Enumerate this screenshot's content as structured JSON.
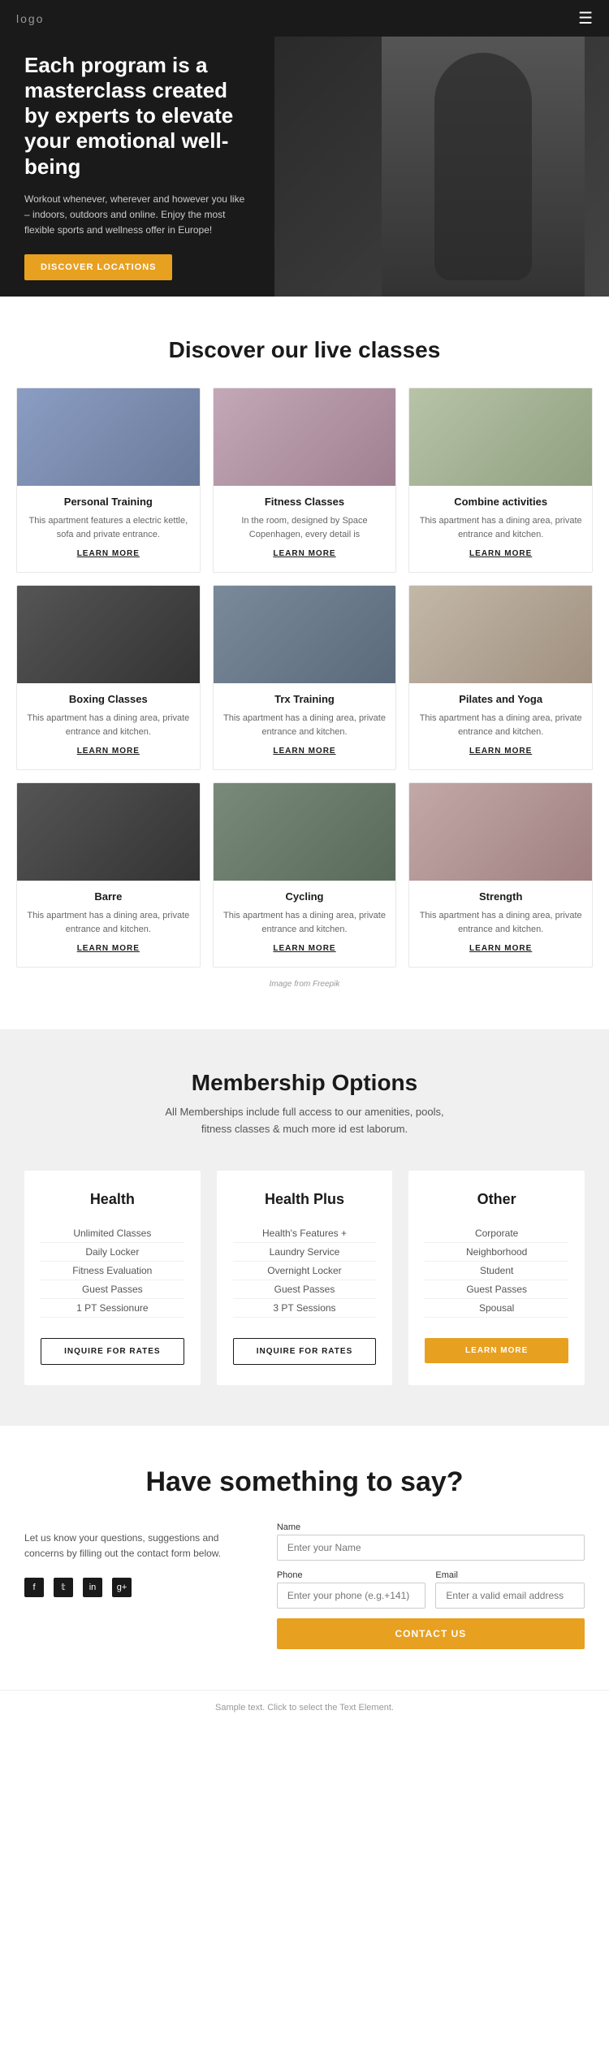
{
  "header": {
    "logo": "logo",
    "menu_icon": "☰"
  },
  "hero": {
    "title": "Each program is a masterclass created by experts to elevate your emotional well-being",
    "subtitle": "Workout whenever, wherever and however you like – indoors, outdoors and online. Enjoy the most flexible sports and wellness offer in Europe!",
    "cta_label": "DISCOVER LOCATIONS"
  },
  "live_classes": {
    "section_title": "Discover our live classes",
    "freepik_note": "Image from Freepik",
    "cards": [
      {
        "name": "Personal Training",
        "desc": "This apartment features a electric kettle, sofa and private entrance.",
        "learn_more": "LEARN MORE",
        "img_class": "img-personal"
      },
      {
        "name": "Fitness Classes",
        "desc": "In the room, designed by Space Copenhagen, every detail is",
        "learn_more": "LEARN MORE",
        "img_class": "img-fitness"
      },
      {
        "name": "Combine activities",
        "desc": "This apartment has a dining area, private entrance and kitchen.",
        "learn_more": "LEARN MORE",
        "img_class": "img-combine"
      },
      {
        "name": "Boxing Classes",
        "desc": "This apartment has a dining area, private entrance and kitchen.",
        "learn_more": "LEARN MORE",
        "img_class": "img-boxing"
      },
      {
        "name": "Trx Training",
        "desc": "This apartment has a dining area, private entrance and kitchen.",
        "learn_more": "LEARN MORE",
        "img_class": "img-trx"
      },
      {
        "name": "Pilates and Yoga",
        "desc": "This apartment has a dining area, private entrance and kitchen.",
        "learn_more": "LEARN MORE",
        "img_class": "img-pilates"
      },
      {
        "name": "Barre",
        "desc": "This apartment has a dining area, private entrance and kitchen.",
        "learn_more": "LEARN MORE",
        "img_class": "img-barre"
      },
      {
        "name": "Cycling",
        "desc": "This apartment has a dining area, private entrance and kitchen.",
        "learn_more": "LEARN MORE",
        "img_class": "img-cycling"
      },
      {
        "name": "Strength",
        "desc": "This apartment has a dining area, private entrance and kitchen.",
        "learn_more": "LEARN MORE",
        "img_class": "img-strength"
      }
    ]
  },
  "membership": {
    "section_title": "Membership Options",
    "subtitle": "All Memberships include full access to our amenities, pools, fitness classes & much more id est laborum.",
    "plans": [
      {
        "title": "Health",
        "features": [
          "Unlimited Classes",
          "Daily Locker",
          "Fitness Evaluation",
          "Guest Passes",
          "1 PT Sessionure"
        ],
        "btn_label": "INQUIRE FOR RATES",
        "btn_type": "outline"
      },
      {
        "title": "Health Plus",
        "features": [
          "Health's Features +",
          "Laundry Service",
          "Overnight Locker",
          "Guest Passes",
          "3 PT Sessions"
        ],
        "btn_label": "INQUIRE FOR RATES",
        "btn_type": "outline"
      },
      {
        "title": "Other",
        "features": [
          "Corporate",
          "Neighborhood",
          "Student",
          "Guest Passes",
          "Spousal"
        ],
        "btn_label": "LEARN MORE",
        "btn_type": "filled"
      }
    ]
  },
  "contact": {
    "section_title": "Have something to say?",
    "description": "Let us know your questions, suggestions and concerns by filling out the contact form below.",
    "social_icons": [
      "f",
      "t",
      "in",
      "g+"
    ],
    "form": {
      "name_label": "Name",
      "name_placeholder": "Enter your Name",
      "phone_label": "Phone",
      "phone_placeholder": "Enter your phone (e.g.+141)",
      "email_label": "Email",
      "email_placeholder": "Enter a valid email address",
      "submit_label": "CONTACT US"
    }
  },
  "footer": {
    "note": "Sample text. Click to select the Text Element."
  }
}
